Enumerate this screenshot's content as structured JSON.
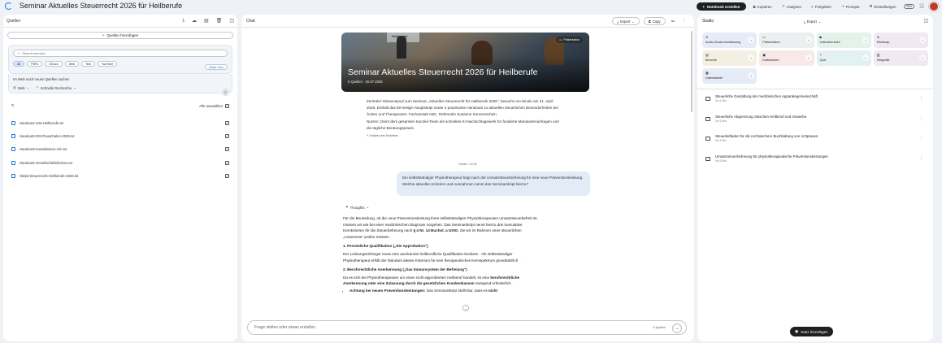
{
  "header": {
    "title": "Seminar Aktuelles Steuerrecht 2026 für Heilberufe",
    "create_notebook": "Notebook erstellen",
    "copy": "Kopieren",
    "analyze": "Analysen",
    "share": "Freigeben",
    "prompts": "Prompts",
    "settings": "Einstellungen",
    "pro_badge": "PRO"
  },
  "sources": {
    "heading": "Quellen",
    "add_button": "Quellen hinzufügen",
    "search_placeholder": "Search sources...",
    "chips": [
      "All",
      "PDFs",
      "GDocs",
      "Web",
      "Text",
      "YouTube"
    ],
    "save_view": "Save View",
    "web_search_label": "Im Web nach neuen Quellen suchen",
    "web_option": "Web",
    "research_option": "Schnelle Recherche",
    "select_all": "Alle auswählen",
    "items": [
      "Handout1-USt-Heilberufe.txt",
      "Handout2-ESt-Pauschalen-2026.txt",
      "Handout3-Investitionen-AfA.txt",
      "Handout4-Gesellschaftsformen.txt",
      "Skript-Steuerrecht-Heilberufe-2026.txt"
    ]
  },
  "chat": {
    "heading": "Chat",
    "export": "Export",
    "copy": "Copy",
    "hero_title": "Seminar Aktuelles Steuerrecht 2026 für Heilberufe",
    "hero_meta": "5 Quellen · 20.07.2026",
    "hero_present": "Präsentation",
    "hero_screen_text": "Heilberufe",
    "summary_p1": "Zentraler Wissenspool zum Seminar „Aktuelles Steuerrecht für Heilberufe 2026\", besucht von Nicole am 21. April 2026. Enthält das 80-seitige Hauptskript sowie 4 praxisnahe Handouts zu aktuellen steuerlichen Besonderheiten bei Ärzten und Therapeuten. Fachanstalt ABC, Referentin Susanne Sonnenschein.",
    "summary_p2": "Nutzen: Dient dem gesamten Kanzlei-Team als schnelles KI-Nachschlagewerk für fundierte Mandantenanfragen und die tägliche Beratungspraxis.",
    "creator_note": "Notizen des Erstellers",
    "timestamp": "Heute • 10:32",
    "user_message": "Ein selbstständiger Physiotherapeut fragt nach der Umsatzsteuerbefreiung für eine neue Präventionsleistung. Welche aktuellen Kriterien und Ausnahmen nennt das Seminarskript hierzu?",
    "thoughts": "Thoughts",
    "answer_intro_a": "Für die Beurteilung, ob die neue Präventionsleistung Ihres selbstständigen Physiotherapeuten umsatzsteuerbefreit ist, müssen wir wie bei einer medizinischen Diagnose vorgehen. Das Seminarskript nennt hierzu drei kumulative Kernkriterien für die Steuerbefreiung nach ",
    "answer_intro_b": "§ 4 Nr. 14 Buchst. a UStG",
    "answer_intro_c": ", die wir im Rahmen einer steuerlichen „Anamnese\" prüfen müssen",
    "answer_h1": "1. Persönliche Qualifikation („Die Approbation\")",
    "answer_p1": "Der Leistungserbringer muss eine anerkannte heilberufliche Qualifikation besitzen . Als selbstständiger Physiotherapeut erfüllt der Mandant dieses Kriterium für sein therapeutisches Kernspektrum grundsätzlich",
    "answer_h2": "2. Berufsrechtliche Anerkennung („Das Immunsystem der Befreiung\")",
    "answer_p2a": "Da es sich bei Physiotherapeuten um einen nicht-approbierten Heilberuf handelt, ist eine ",
    "answer_p2b": "berufsrechtliche Anerkennung oder eine Zulassung durch die gesetzlichen Krankenkassen",
    "answer_p2c": " zwingend erforderlich",
    "answer_li_b": "Achtung bei neuen Präventionsleistungen:",
    "answer_li_t": " Das Seminarskript stellt klar, dass es ",
    "answer_li_b2": "nicht",
    "composer_placeholder": "Frage stellen oder etwas erstellen",
    "composer_count": "5 Quellen"
  },
  "studio": {
    "heading": "Studio",
    "export": "Export",
    "tiles": [
      {
        "label": "Audio-Zusammenfassung",
        "icon": "audio-icon",
        "color": "#e5ecf7"
      },
      {
        "label": "Präsentation",
        "icon": "slides-icon",
        "color": "#eceff0"
      },
      {
        "label": "Videoübersicht",
        "icon": "video-icon",
        "color": "#e4f2ec"
      },
      {
        "label": "Mindmap",
        "icon": "mindmap-icon",
        "color": "#f2e8f3"
      },
      {
        "label": "Berichte",
        "icon": "report-icon",
        "color": "#f4efe3"
      },
      {
        "label": "Karteikarten",
        "icon": "flashcards-icon",
        "color": "#f8e9e9"
      },
      {
        "label": "Quiz",
        "icon": "quiz-icon",
        "color": "#e3f0f4"
      },
      {
        "label": "Infografik",
        "icon": "infographic-icon",
        "color": "#f2e8f3"
      },
      {
        "label": "Datentabelle",
        "icon": "table-icon",
        "color": "#e5ecf7"
      }
    ],
    "notes": [
      {
        "title": "Steuerliche Gestaltung der medizinischen Apparategemeinschaft",
        "sub": "Vor 1 Min."
      },
      {
        "title": "Steuerliche Abgrenzung zwischen Heilberuf und Gewerbe",
        "sub": "Vor 1 Min."
      },
      {
        "title": "Steuerleitfaden für die rechtssichere Buchhaltung von Arztpraxen",
        "sub": "Vor 2 Min."
      },
      {
        "title": "Umsatzsteuerbefreiung für physiotherapeutische Präventionsleistungen",
        "sub": "Vor 3 Min."
      }
    ],
    "add_note": "Notiz hinzufügen"
  }
}
